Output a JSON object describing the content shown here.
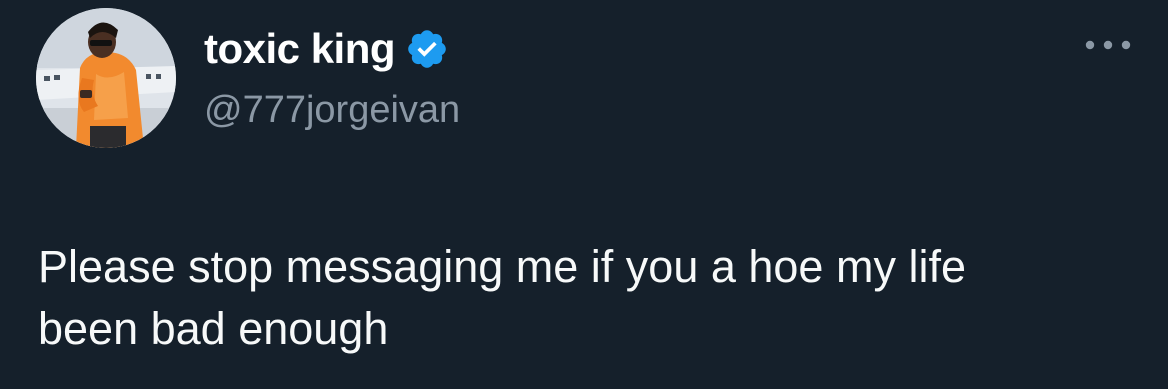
{
  "tweet": {
    "author": {
      "display_name": "toxic king",
      "handle": "@777jorgeivan",
      "verified": true,
      "avatar_icon": "profile-photo"
    },
    "text": "Please stop messaging me if you a hoe my life\nbeen bad enough",
    "more_icon": "ellipsis-icon",
    "verified_icon": "verified-badge-icon"
  },
  "colors": {
    "background": "#15202b",
    "display_name": "#ffffff",
    "handle": "#8b98a5",
    "text": "#f7f9f9",
    "verified": "#1d9bf0",
    "more_dots": "#8b98a5"
  }
}
